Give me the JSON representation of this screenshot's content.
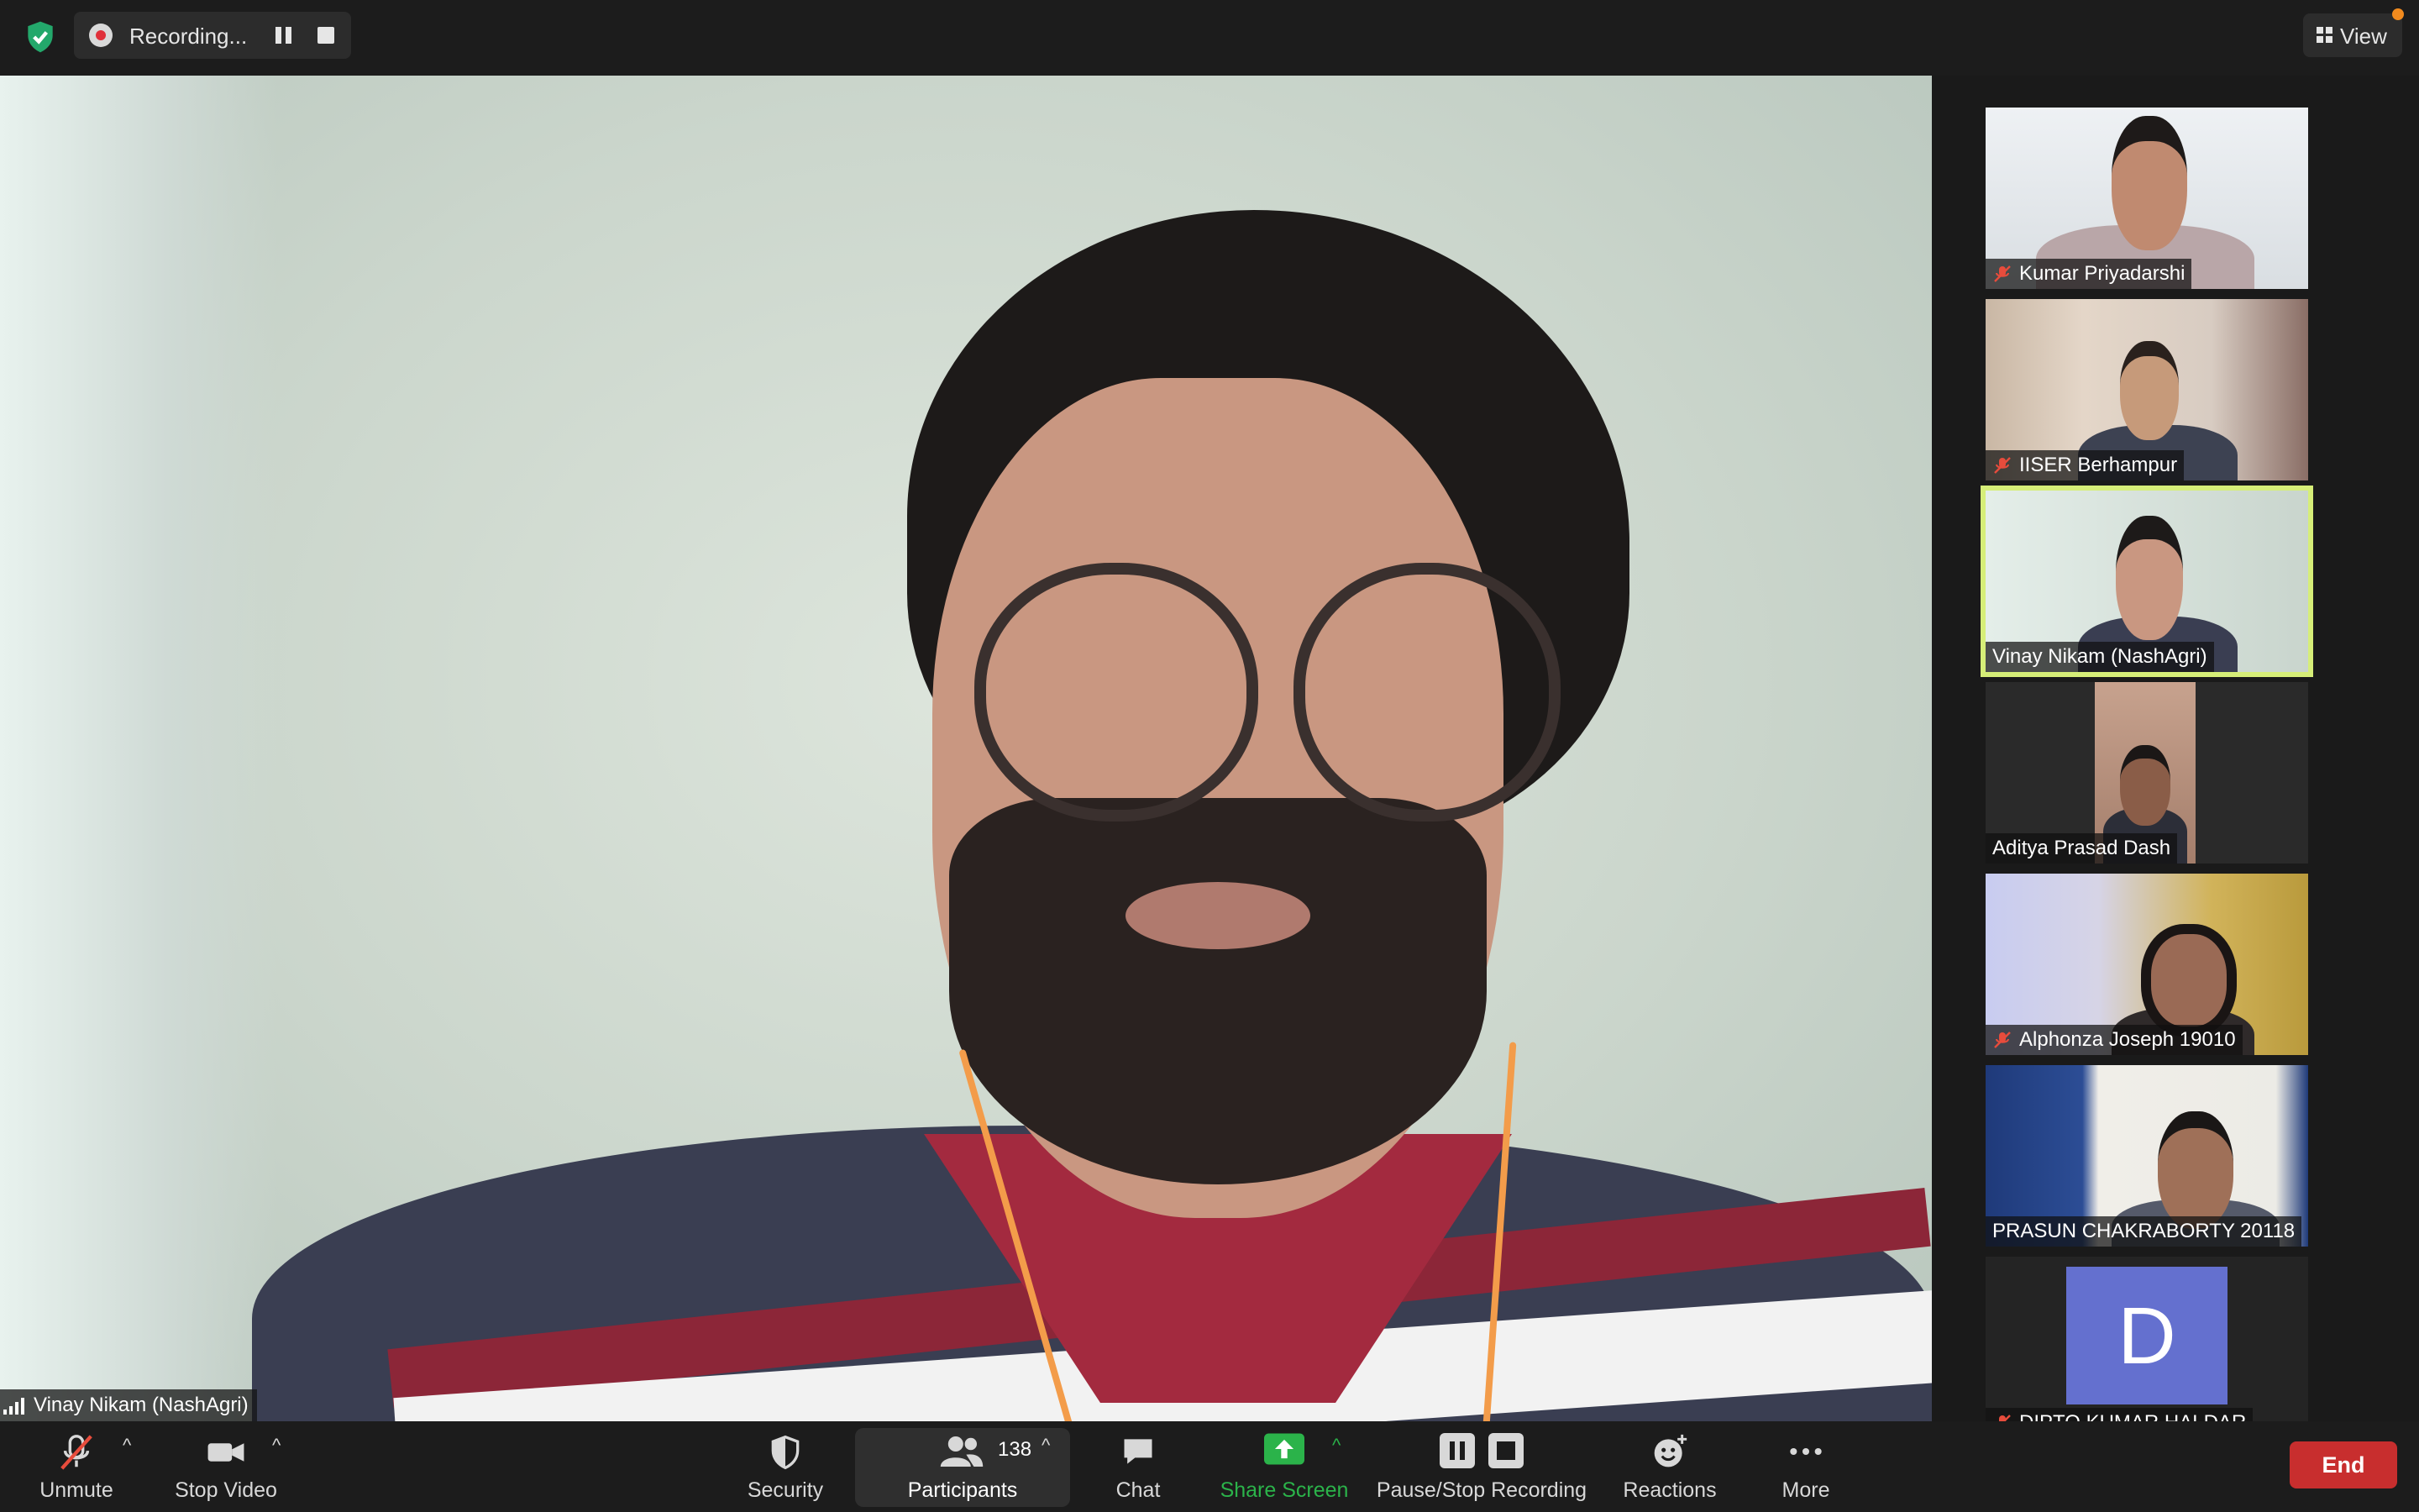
{
  "topbar": {
    "recording_text": "Recording...",
    "view_label": "View",
    "icons": {
      "security": "shield-check-icon",
      "record": "record-dot-icon",
      "pause": "pause-icon",
      "stop": "stop-icon",
      "view": "grid-view-icon"
    }
  },
  "main_video": {
    "speaker_name": "Vinay Nikam (NashAgri)"
  },
  "gallery": {
    "tiles": [
      {
        "name": "Kumar Priyadarshi",
        "muted": true,
        "active": false
      },
      {
        "name": "IISER Berhampur",
        "muted": true,
        "active": false
      },
      {
        "name": "Vinay Nikam (NashAgri)",
        "muted": false,
        "active": true
      },
      {
        "name": "Aditya Prasad Dash",
        "muted": false,
        "active": false
      },
      {
        "name": "Alphonza Joseph 19010",
        "muted": true,
        "active": false
      },
      {
        "name": "PRASUN CHAKRABORTY 20118",
        "muted": false,
        "active": false
      },
      {
        "name": "DIPTO  KUMAR HALDAR",
        "muted": true,
        "active": false,
        "avatar_letter": "D"
      }
    ]
  },
  "toolbar": {
    "unmute": "Unmute",
    "stop_video": "Stop Video",
    "security": "Security",
    "participants": "Participants",
    "participants_count": "138",
    "chat": "Chat",
    "share_screen": "Share Screen",
    "pause_stop_recording": "Pause/Stop Recording",
    "reactions": "Reactions",
    "more": "More",
    "end": "End"
  },
  "colors": {
    "accent_green": "#23a86b",
    "active_speaker_outline": "#d6ee78",
    "end_button": "#c82e2e",
    "avatar_bg": "#6470cf",
    "share_green": "#2bb34a"
  }
}
